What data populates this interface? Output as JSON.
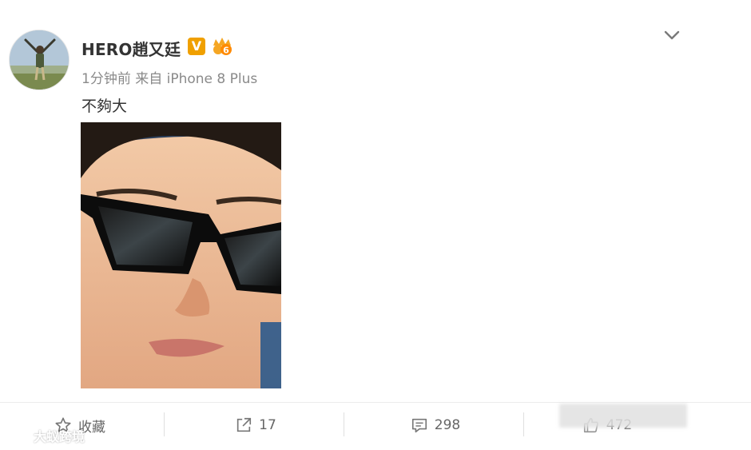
{
  "post": {
    "username": "HERO趙又廷",
    "verified_badge": "V",
    "level_badge": "6",
    "meta": "1分钟前 来自 iPhone 8 Plus",
    "text": "不夠大"
  },
  "actions": {
    "favorite": {
      "label": "收藏",
      "icon": "star-icon"
    },
    "repost": {
      "count": "17",
      "icon": "share-icon"
    },
    "comment": {
      "count": "298",
      "icon": "comment-icon"
    },
    "like": {
      "count": "472",
      "icon": "thumbs-up-icon"
    }
  },
  "watermark": {
    "text": "大蚁跨境"
  },
  "colors": {
    "verified": "#f0a000",
    "meta_gray": "#8a8a8a",
    "divider": "#ececec"
  }
}
